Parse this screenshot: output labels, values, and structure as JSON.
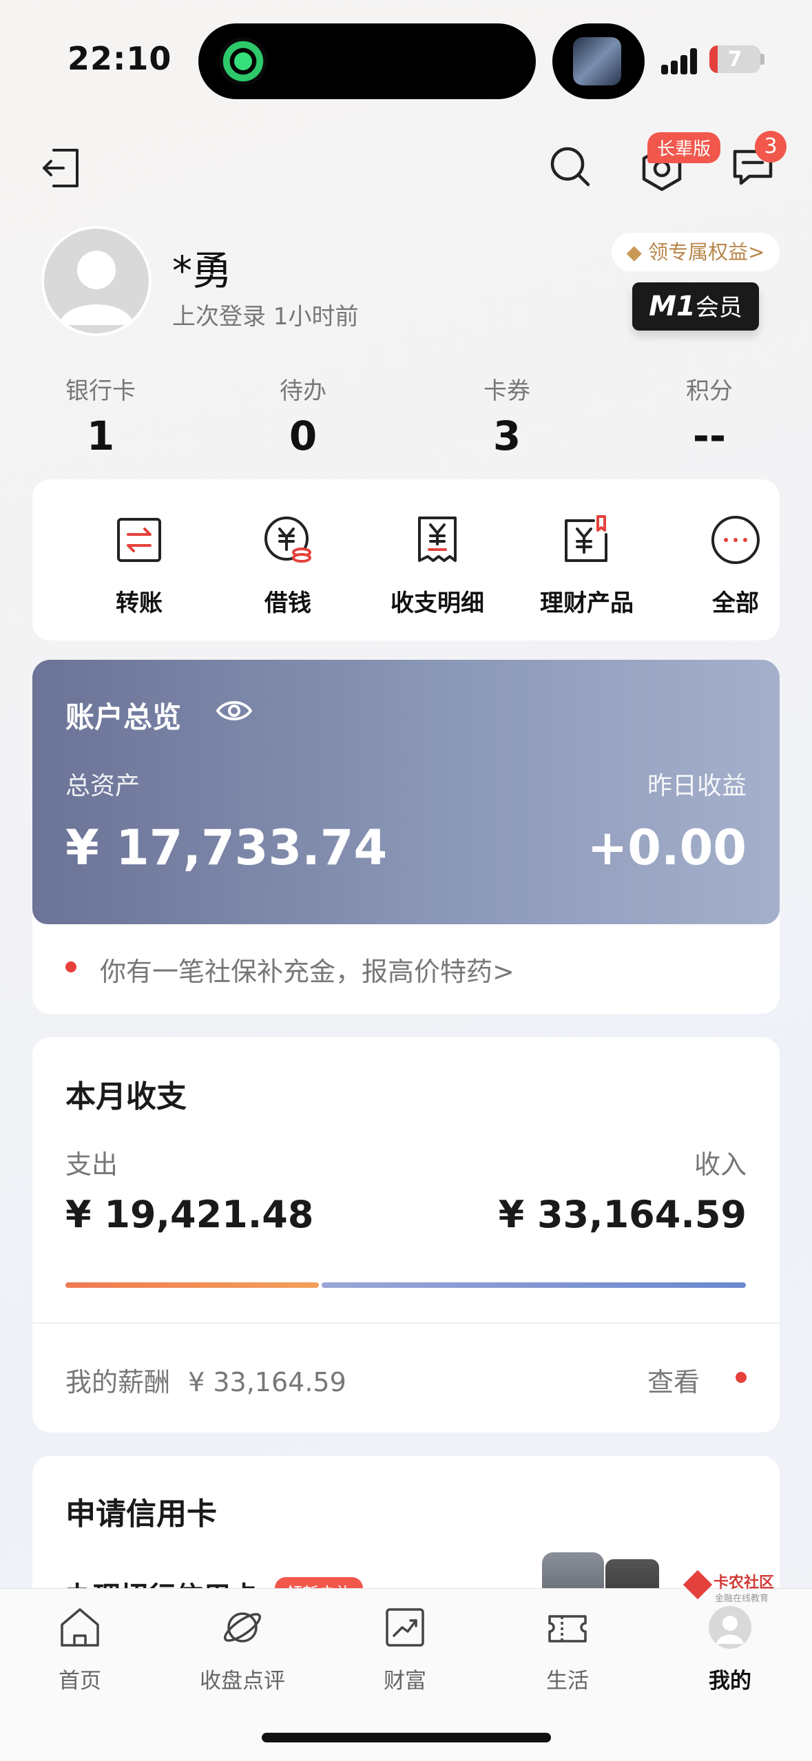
{
  "status_bar": {
    "time": "22:10",
    "battery": "7"
  },
  "header": {
    "elder_badge": "长辈版",
    "message_count": "3"
  },
  "profile": {
    "name": "*勇",
    "last_login": "上次登录 1小时前",
    "perk_link": "领专属权益>",
    "member_brand": "M1",
    "member_label": "会员"
  },
  "stats": [
    {
      "label": "银行卡",
      "value": "1"
    },
    {
      "label": "待办",
      "value": "0"
    },
    {
      "label": "卡券",
      "value": "3"
    },
    {
      "label": "积分",
      "value": "--"
    }
  ],
  "quick_actions": [
    {
      "label": "转账",
      "icon": "transfer-icon"
    },
    {
      "label": "借钱",
      "icon": "loan-icon"
    },
    {
      "label": "收支明细",
      "icon": "receipt-icon"
    },
    {
      "label": "理财产品",
      "icon": "wealth-product-icon"
    },
    {
      "label": "全部",
      "icon": "more-icon"
    }
  ],
  "overview": {
    "title": "账户总览",
    "total_label": "总资产",
    "total_value": "¥ 17,733.74",
    "yesterday_label": "昨日收益",
    "yesterday_value": "+0.00",
    "notice": "你有一笔社保补充金，报高价特药>"
  },
  "monthly": {
    "title": "本月收支",
    "expense_label": "支出",
    "expense_value": "¥ 19,421.48",
    "income_label": "收入",
    "income_value": "¥ 33,164.59",
    "salary_label": "我的薪酬",
    "salary_value": "¥ 33,164.59",
    "view_label": "查看"
  },
  "credit": {
    "title": "申请信用卡",
    "subtitle": "办理招行信用卡",
    "tag": "领新户礼"
  },
  "tabs": [
    {
      "label": "首页",
      "icon": "home-icon"
    },
    {
      "label": "收盘点评",
      "icon": "planet-icon"
    },
    {
      "label": "财富",
      "icon": "chart-icon"
    },
    {
      "label": "生活",
      "icon": "ticket-icon"
    },
    {
      "label": "我的",
      "icon": "profile-icon"
    }
  ],
  "watermark": {
    "title": "卡农社区",
    "subtitle": "金融在线教育"
  },
  "colors": {
    "accent": "#e5413c",
    "overview_start": "#6b7397",
    "overview_end": "#a4b0cb",
    "expense": "#f07a52",
    "income": "#6b88cf"
  }
}
